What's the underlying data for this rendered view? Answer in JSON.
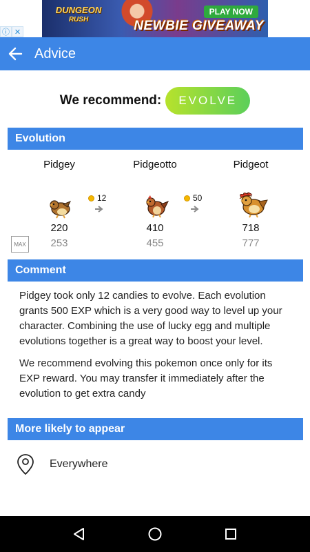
{
  "ad": {
    "logo_title": "DUNGEON",
    "logo_sub": "RUSH",
    "play_label": "PLAY NOW",
    "headline": "NEWBIE GIVEAWAY",
    "choice_icons": [
      "ad-info-icon",
      "ad-close-icon"
    ]
  },
  "appbar": {
    "title": "Advice",
    "color": "#3d86e6"
  },
  "recommend": {
    "label": "We recommend:",
    "action": "EVOLVE"
  },
  "evolution": {
    "header": "Evolution",
    "stages": [
      {
        "name": "Pidgey",
        "cp": "220",
        "max_cp": "253"
      },
      {
        "name": "Pidgeotto",
        "cp": "410",
        "max_cp": "455"
      },
      {
        "name": "Pidgeot",
        "cp": "718",
        "max_cp": "777"
      }
    ],
    "candies": [
      "12",
      "50"
    ],
    "max_label": "MAX"
  },
  "comment": {
    "header": "Comment",
    "paragraphs": [
      "Pidgey took only 12 candies to evolve. Each evolution grants 500 EXP which is a very good way to level up your character. Combining the use of lucky egg and multiple evolutions together is a great way to boost your level.",
      "We recommend evolving this pokemon once only for its EXP reward. You may transfer it immediately after the evolution to get extra candy"
    ]
  },
  "appear": {
    "header": "More likely to appear",
    "location": "Everywhere"
  },
  "navbar": {
    "icons": [
      "back-triangle-icon",
      "home-circle-icon",
      "recents-square-icon"
    ]
  }
}
